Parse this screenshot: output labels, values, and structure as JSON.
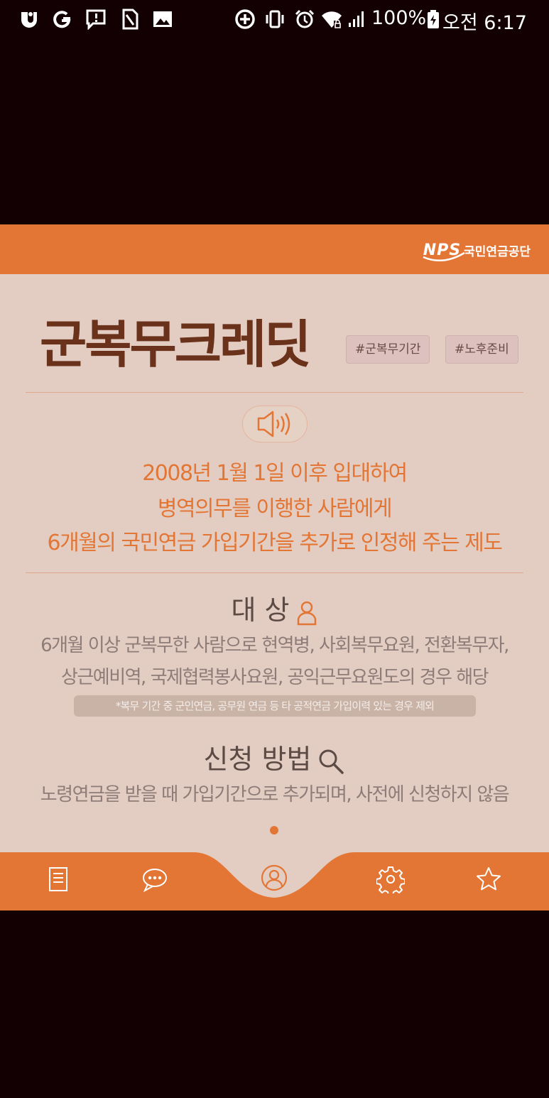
{
  "status_bar": {
    "battery": "100%",
    "time": "오전 6:17",
    "left_icons": [
      "u-plus-icon",
      "g-sync-icon",
      "chat-bubble-icon",
      "sim-card-icon",
      "image-icon"
    ],
    "right_icons": [
      "data-saver-icon",
      "vibrate-icon",
      "alarm-icon",
      "wifi-icon",
      "signal-icon",
      "battery-icon"
    ]
  },
  "card": {
    "logo": {
      "word": "NPS",
      "name": "국민연금공단"
    },
    "title": "군복무크레딧",
    "tags": [
      "#군복무기간",
      "#노후준비"
    ],
    "intro": [
      "2008년 1월 1일 이후 입대하여",
      "병역의무를 이행한 사람에게",
      "6개월의 국민연금 가입기간을 추가로 인정해 주는 제도"
    ],
    "target": {
      "heading": "대 상",
      "lines": [
        "6개월 이상 군복무한 사람으로 현역병, 사회복무요원, 전환복무자,",
        "상근예비역, 국제협력봉사요원, 공익근무요원도의 경우 해당"
      ],
      "note": "*복무 기간 중 군인연금, 공무원 연금 등 타 공적연금 가입이력 있는 경우 제외"
    },
    "apply": {
      "heading": "신청 방법",
      "line": "노령연금을 받을 때 가입기간으로 추가되며, 사전에 신청하지 않음"
    }
  },
  "bottom_nav": {
    "items": [
      "document-icon",
      "chat-icon",
      "profile-icon",
      "gear-icon",
      "star-icon"
    ],
    "active": "profile-icon"
  },
  "colors": {
    "accent": "#e37634",
    "title": "#6a311b",
    "card_bg": "#e3cdc3",
    "page_bg": "#120002"
  }
}
